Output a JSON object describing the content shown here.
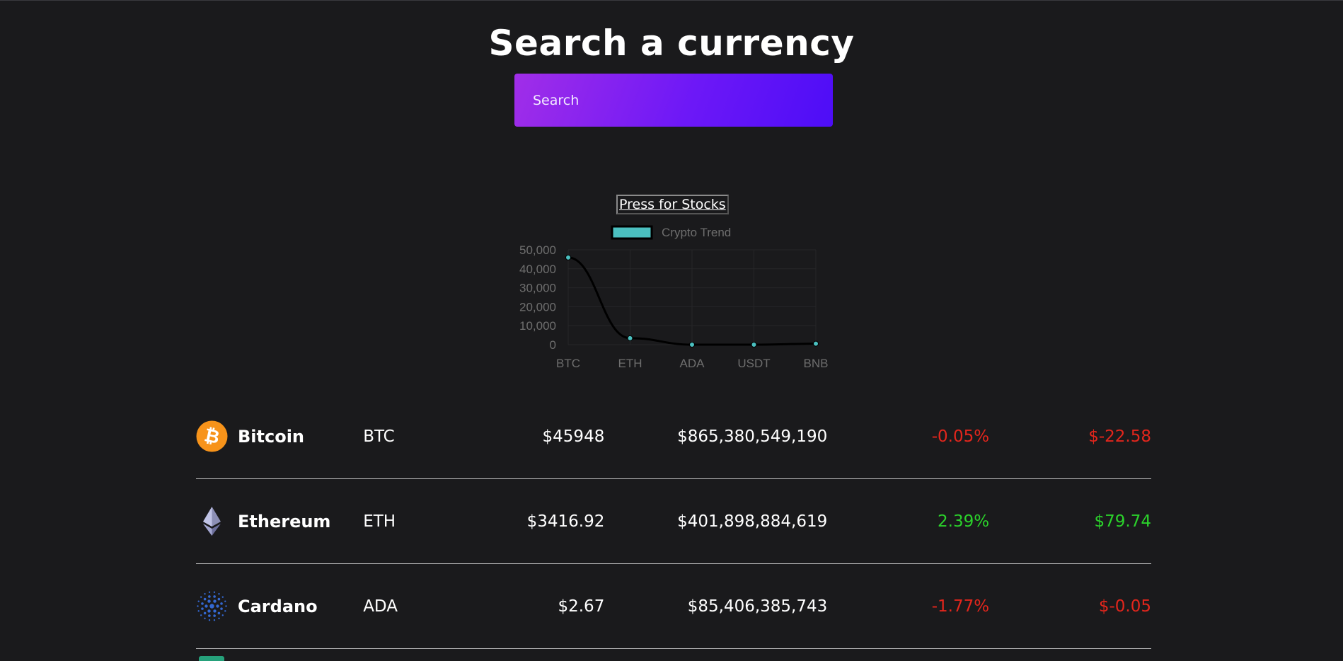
{
  "header": {
    "title": "Search a currency"
  },
  "search": {
    "placeholder": "Search"
  },
  "stocks_button": {
    "label": "Press for Stocks"
  },
  "chart_data": {
    "type": "line",
    "categories": [
      "BTC",
      "ETH",
      "ADA",
      "USDT",
      "BNB"
    ],
    "series": [
      {
        "name": "Crypto Trend",
        "values": [
          45948,
          3416.92,
          2.67,
          1,
          500
        ]
      }
    ],
    "ylim": [
      0,
      50000
    ],
    "yticks": [
      "50,000",
      "40,000",
      "30,000",
      "20,000",
      "10,000",
      "0"
    ],
    "legend_position": "top",
    "grid": true,
    "colors": {
      "line": "#000000",
      "point": "#4bc0c0",
      "legend_swatch": "#4bc0c0"
    }
  },
  "coins": [
    {
      "name": "Bitcoin",
      "symbol": "BTC",
      "price": "$45948",
      "market_cap": "$865,380,549,190",
      "change_pct": "-0.05%",
      "change": "$-22.58",
      "trend": "negative",
      "icon": "bitcoin-icon"
    },
    {
      "name": "Ethereum",
      "symbol": "ETH",
      "price": "$3416.92",
      "market_cap": "$401,898,884,619",
      "change_pct": "2.39%",
      "change": "$79.74",
      "trend": "positive",
      "icon": "ethereum-icon"
    },
    {
      "name": "Cardano",
      "symbol": "ADA",
      "price": "$2.67",
      "market_cap": "$85,406,385,743",
      "change_pct": "-1.77%",
      "change": "$-0.05",
      "trend": "negative",
      "icon": "cardano-icon"
    }
  ],
  "colors": {
    "positive": "#2bd22b",
    "negative": "#e3261c",
    "search_gradient_start": "#a12ee8",
    "search_gradient_end": "#4d0df7"
  }
}
